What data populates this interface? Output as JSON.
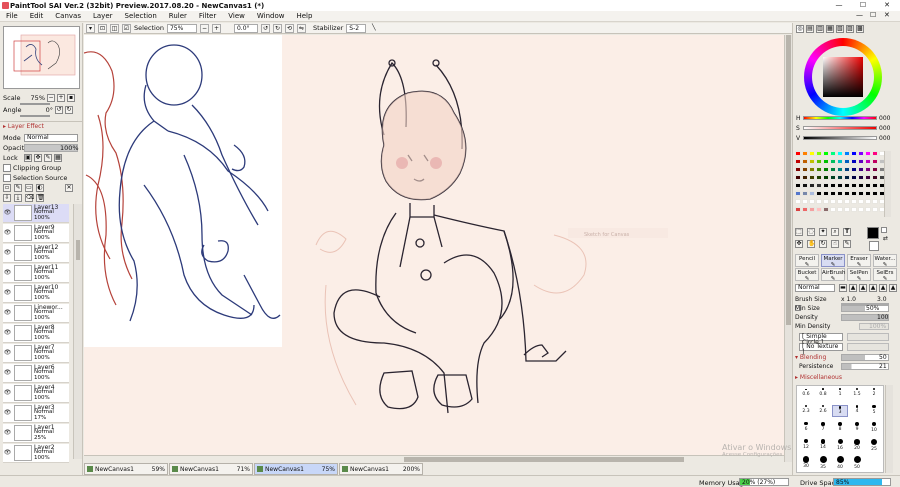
{
  "window": {
    "title": "PaintTool SAI Ver.2 (32bit) Preview.2017.08.20 - NewCanvas1 (*)",
    "minimize": "—",
    "maximize": "☐",
    "close": "✕"
  },
  "menu": [
    "File",
    "Edit",
    "Canvas",
    "Layer",
    "Selection",
    "Ruler",
    "Filter",
    "View",
    "Window",
    "Help"
  ],
  "menu_right": {
    "minimize": "—",
    "restore": "☐",
    "close": "✕"
  },
  "toolbar": {
    "selection_label": "Selection",
    "zoom": "75%",
    "angle": "0.0°",
    "stabilizer_label": "Stabilizer",
    "stabilizer_value": "S-2"
  },
  "navigator": {
    "scale_label": "Scale",
    "scale_value": "75%",
    "angle_label": "Angle",
    "angle_value": "0°"
  },
  "layer_effect": {
    "header": "Layer Effect",
    "mode_label": "Mode",
    "mode_value": "Normal",
    "opacity_label": "Opacity",
    "opacity_value": "100%",
    "lock_label": "Lock",
    "clipping_label": "Clipping Group",
    "selsource_label": "Selection Source"
  },
  "layers": [
    {
      "name": "Layer13",
      "mode": "Normal",
      "opacity": "100%",
      "active": true
    },
    {
      "name": "Layer9",
      "mode": "Normal",
      "opacity": "100%",
      "active": false
    },
    {
      "name": "Layer12",
      "mode": "Normal",
      "opacity": "100%",
      "active": false
    },
    {
      "name": "Layer11",
      "mode": "Normal",
      "opacity": "100%",
      "active": false
    },
    {
      "name": "Layer10",
      "mode": "Normal",
      "opacity": "100%",
      "active": false
    },
    {
      "name": "Linewor...",
      "mode": "Normal",
      "opacity": "100%",
      "active": false
    },
    {
      "name": "Layer8",
      "mode": "Normal",
      "opacity": "100%",
      "active": false
    },
    {
      "name": "Layer7",
      "mode": "Normal",
      "opacity": "100%",
      "active": false
    },
    {
      "name": "Layer6",
      "mode": "Normal",
      "opacity": "100%",
      "active": false
    },
    {
      "name": "Layer4",
      "mode": "Normal",
      "opacity": "100%",
      "active": false
    },
    {
      "name": "Layer3",
      "mode": "Normal",
      "opacity": "17%",
      "active": false
    },
    {
      "name": "Layer1",
      "mode": "Normal",
      "opacity": "25%",
      "active": false
    },
    {
      "name": "Layer2",
      "mode": "Normal",
      "opacity": "100%",
      "active": false
    }
  ],
  "tabs": [
    {
      "name": "NewCanvas1",
      "zoom": "59%",
      "active": false
    },
    {
      "name": "NewCanvas1",
      "zoom": "71%",
      "active": false
    },
    {
      "name": "NewCanvas1",
      "zoom": "75%",
      "active": true
    },
    {
      "name": "NewCanvas1",
      "zoom": "200%",
      "active": false
    }
  ],
  "status": {
    "memory_label": "Memory Usage",
    "memory_value": "20% (27%)",
    "drive_label": "Drive Space",
    "drive_value": "85%",
    "watermark_line1": "Ativar o Windows",
    "watermark_line2": "Acesse Configurações"
  },
  "color": {
    "hsv": [
      {
        "label": "H",
        "value": "000"
      },
      {
        "label": "S",
        "value": "000"
      },
      {
        "label": "V",
        "value": "000"
      }
    ],
    "primary": "#000000",
    "secondary": "#ffffff"
  },
  "tools": [
    {
      "label": "Pencil",
      "active": false
    },
    {
      "label": "Marker",
      "active": true
    },
    {
      "label": "Eraser",
      "active": false
    },
    {
      "label": "Water...",
      "active": false
    },
    {
      "label": "Bucket",
      "active": false
    },
    {
      "label": "AirBrush",
      "active": false
    },
    {
      "label": "SelPen",
      "active": false
    },
    {
      "label": "SelErs",
      "active": false
    }
  ],
  "brush": {
    "mode": "Normal",
    "size_label": "Brush Size",
    "size_mult": "x 1.0",
    "size_value": "3.0",
    "minsize_label": "Min Size",
    "minsize_value": "50%",
    "density_label": "Density",
    "density_value": "100",
    "mindensity_label": "Min Density",
    "mindensity_value": "100%",
    "shape": "[ Simple Circle ]",
    "texture": "[ No Texture ]",
    "blending_label": "Blending",
    "blending_value": "50",
    "persistence_label": "Persistence",
    "persistence_value": "21",
    "misc_label": "Miscellaneous",
    "sizes": [
      "0.6",
      "0.8",
      "1",
      "1.5",
      "2",
      "2.3",
      "2.6",
      "3",
      "4",
      "5",
      "6",
      "7",
      "8",
      "9",
      "10",
      "12",
      "14",
      "16",
      "20",
      "25",
      "30",
      "35",
      "40",
      "50"
    ]
  },
  "canvas": {
    "hint": "Sketch for Canvas"
  }
}
